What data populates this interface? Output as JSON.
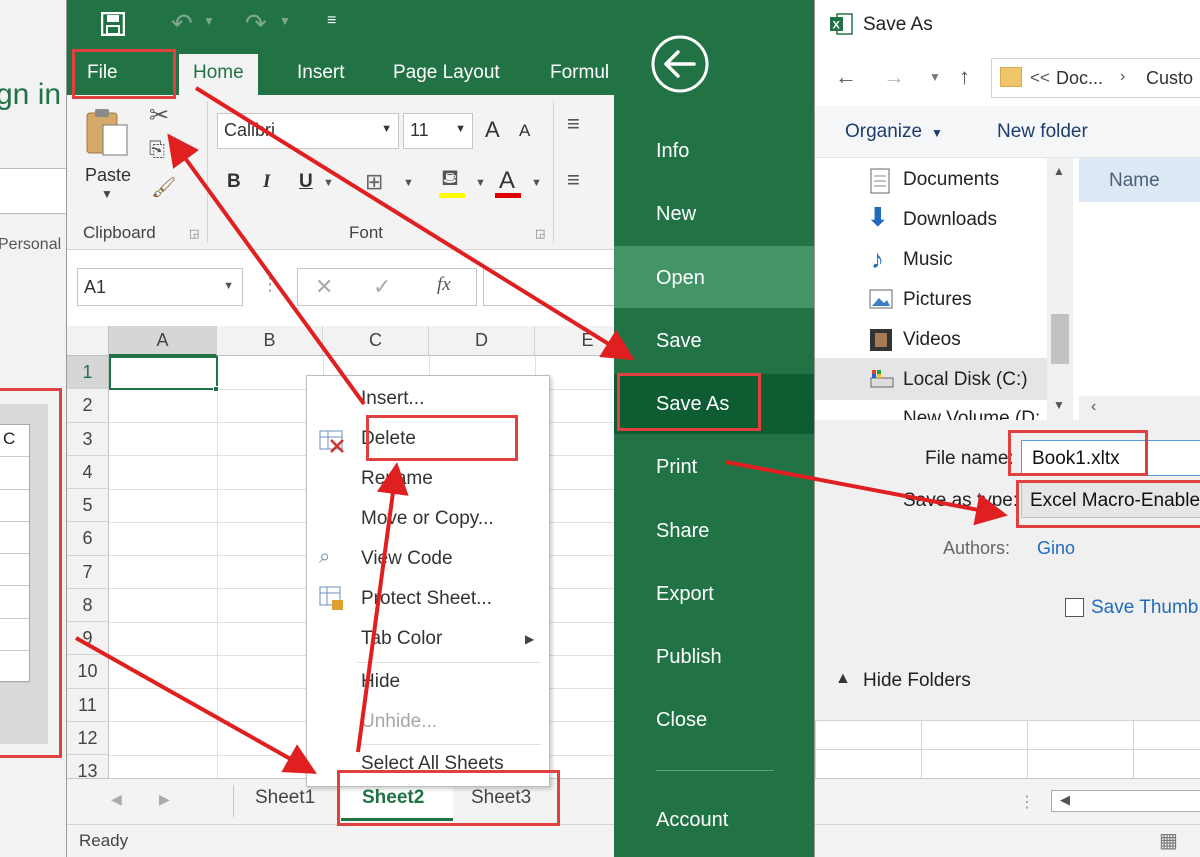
{
  "colors": {
    "excel_green": "#217346",
    "backstage_hover": "#439467",
    "backstage_selected": "#0e5c32",
    "annotation_red": "#e02020",
    "link_blue": "#1f6cbf"
  },
  "background_window": {
    "signin_text": "gn in",
    "personal_text": "Personal",
    "grid_header": "C"
  },
  "excel": {
    "quick_access": {
      "save_icon": "save-icon",
      "undo_icon": "undo-icon",
      "redo_icon": "redo-icon",
      "customize_icon": "customize-icon"
    },
    "tabs": [
      "File",
      "Home",
      "Insert",
      "Page Layout",
      "Formul"
    ],
    "clipboard": {
      "paste_label": "Paste",
      "group_label": "Clipboard"
    },
    "font": {
      "name": "Calibri",
      "size": "11",
      "group_label": "Font",
      "bold": "B",
      "italic": "I",
      "underline": "U",
      "grow": "A",
      "shrink": "A",
      "font_color": "A"
    },
    "name_box": "A1",
    "fx_label": "fx",
    "columns": [
      "A",
      "B",
      "C",
      "D",
      "E"
    ],
    "rows": [
      "1",
      "2",
      "3",
      "4",
      "5",
      "6",
      "7",
      "8",
      "9",
      "10",
      "11",
      "12",
      "13"
    ],
    "sheets": [
      "Sheet1",
      "Sheet2",
      "Sheet3"
    ],
    "status": "Ready",
    "context_menu": [
      {
        "label": "Insert...",
        "disabled": false
      },
      {
        "label": "Delete",
        "disabled": false
      },
      {
        "label": "Rename",
        "disabled": false
      },
      {
        "label": "Move or Copy...",
        "disabled": false
      },
      {
        "label": "View Code",
        "disabled": false
      },
      {
        "label": "Protect Sheet...",
        "disabled": false
      },
      {
        "label": "Tab Color",
        "disabled": false
      },
      {
        "label": "Hide",
        "disabled": false
      },
      {
        "label": "Unhide...",
        "disabled": true
      },
      {
        "label": "Select All Sheets",
        "disabled": false
      }
    ]
  },
  "backstage": {
    "items": [
      "Info",
      "New",
      "Open",
      "Save",
      "Save As",
      "Print",
      "Share",
      "Export",
      "Publish",
      "Close",
      "Account"
    ],
    "selected": "Save As",
    "hover": "Open"
  },
  "dialog": {
    "title": "Save As",
    "path": [
      "Doc...",
      "Custo"
    ],
    "path_prefix": "<<",
    "organize_label": "Organize",
    "new_folder_label": "New folder",
    "nav_items": [
      "Documents",
      "Downloads",
      "Music",
      "Pictures",
      "Videos",
      "Local Disk (C:)",
      "New Volume (D:"
    ],
    "column_name": "Name",
    "file_name_label": "File name:",
    "file_name_value": "Book1.xltx",
    "save_type_label": "Save as type:",
    "save_type_value": "Excel Macro-Enable",
    "authors_label": "Authors:",
    "authors_value": "Gino",
    "save_thumbnail_label": "Save Thumb",
    "hide_folders_label": "Hide Folders"
  }
}
